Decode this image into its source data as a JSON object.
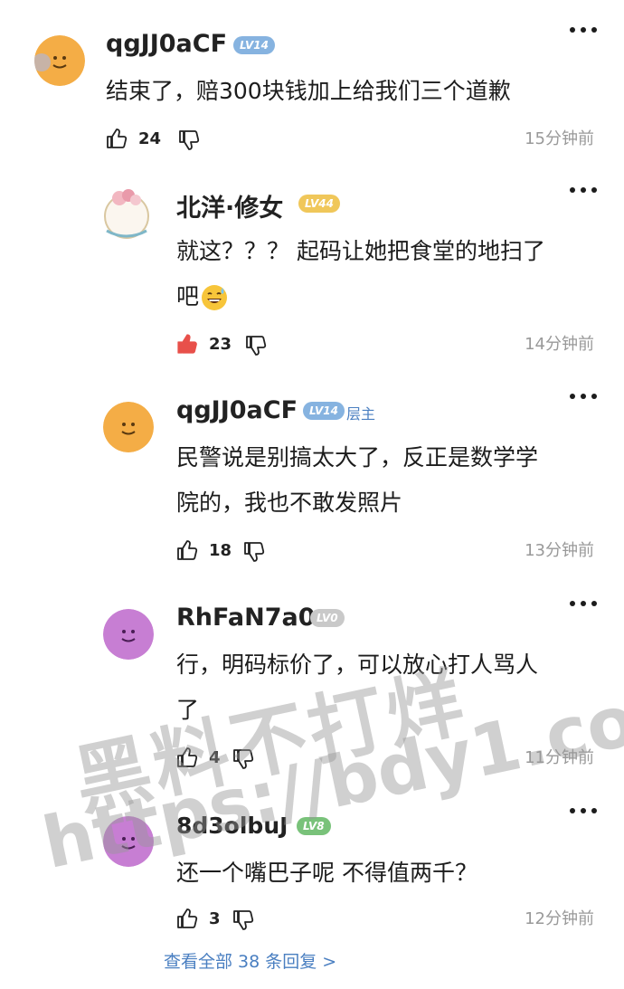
{
  "comments": [
    {
      "username": "qgJJ0aCF",
      "level": "LV14",
      "op_tag": "",
      "text_lines": [
        "结束了，赔300块钱加上给我们三个道歉"
      ],
      "likes": "24",
      "time": "15分钟前"
    },
    {
      "username": "北洋·修女",
      "level": "LV44",
      "op_tag": "",
      "text_lines": [
        "就这？？？ 起码让她把食堂的地扫了",
        "吧"
      ],
      "likes": "23",
      "time": "14分钟前"
    },
    {
      "username": "qgJJ0aCF",
      "level": "LV14",
      "op_tag": "层主",
      "text_lines": [
        "民警说是别搞太大了，反正是数学学",
        "院的，我也不敢发照片"
      ],
      "likes": "18",
      "time": "13分钟前"
    },
    {
      "username": "RhFaN7a0",
      "level": "LV0",
      "op_tag": "",
      "text_lines": [
        "行，明码标价了，可以放心打人骂人",
        "了"
      ],
      "likes": "4",
      "time": "11分钟前"
    },
    {
      "username": "8d3olbuJ",
      "level": "LV8",
      "op_tag": "",
      "text_lines": [
        "还一个嘴巴子呢 不得值两千？"
      ],
      "likes": "3",
      "time": "12分钟前"
    }
  ],
  "view_all": "查看全部 38 条回复 >",
  "watermark": {
    "line1": "黑料不打烊",
    "line2": "https://bdy1.co"
  },
  "icons": {
    "like": "thumbs-up-icon",
    "dislike": "thumbs-down-icon",
    "more": "more-dots-icon"
  },
  "colors": {
    "link": "#4a7fc1",
    "liked": "#e8504a",
    "meta": "#999999"
  }
}
